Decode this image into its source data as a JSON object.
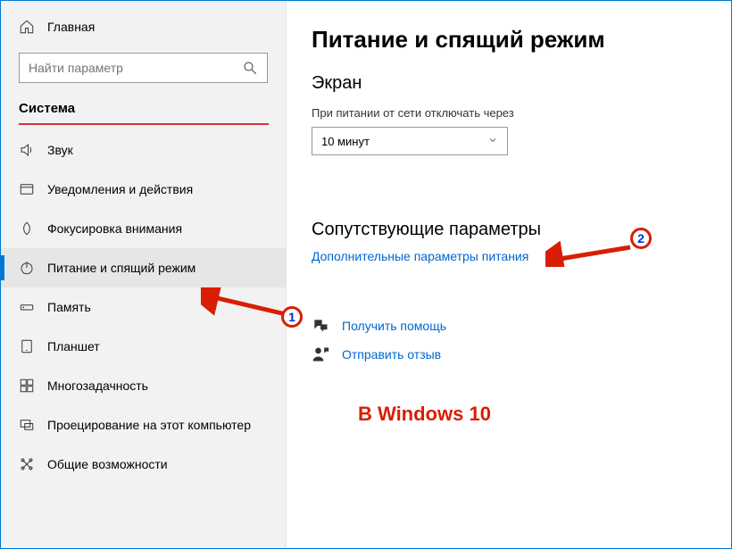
{
  "sidebar": {
    "home": "Главная",
    "search_placeholder": "Найти параметр",
    "category": "Система",
    "items": [
      {
        "label": "Звук",
        "icon": "sound-icon"
      },
      {
        "label": "Уведомления и действия",
        "icon": "notifications-icon"
      },
      {
        "label": "Фокусировка внимания",
        "icon": "focus-icon"
      },
      {
        "label": "Питание и спящий режим",
        "icon": "power-icon",
        "selected": true
      },
      {
        "label": "Память",
        "icon": "storage-icon"
      },
      {
        "label": "Планшет",
        "icon": "tablet-icon"
      },
      {
        "label": "Многозадачность",
        "icon": "multitask-icon"
      },
      {
        "label": "Проецирование на этот компьютер",
        "icon": "projecting-icon"
      },
      {
        "label": "Общие возможности",
        "icon": "shared-icon"
      }
    ]
  },
  "main": {
    "title": "Питание и спящий режим",
    "screen_section": "Экран",
    "screen_label": "При питании от сети отключать через",
    "screen_value": "10 минут",
    "related_title": "Сопутствующие параметры",
    "related_link": "Дополнительные параметры питания",
    "help_link": "Получить помощь",
    "feedback_link": "Отправить отзыв"
  },
  "annotations": {
    "badge1": "1",
    "badge2": "2",
    "caption": "В Windows 10"
  }
}
